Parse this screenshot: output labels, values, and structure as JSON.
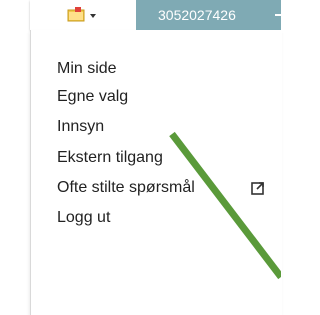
{
  "header": {
    "menu_button": {
      "icon": "folder-note-icon",
      "caret_icon": "caret-down-icon"
    },
    "account": {
      "number": "3052027426",
      "color": "#7faab4"
    }
  },
  "menu": {
    "items": [
      {
        "label": "Min side"
      },
      {
        "label": "Egne valg"
      },
      {
        "label": "Innsyn"
      },
      {
        "label": "Ekstern tilgang"
      },
      {
        "label": "Ofte stilte spørsmål",
        "icon": "external-link-icon"
      },
      {
        "label": "Logg ut"
      }
    ]
  },
  "annotation": {
    "arrow_color": "#5a9a3a",
    "icon": "arrow-annotation"
  }
}
